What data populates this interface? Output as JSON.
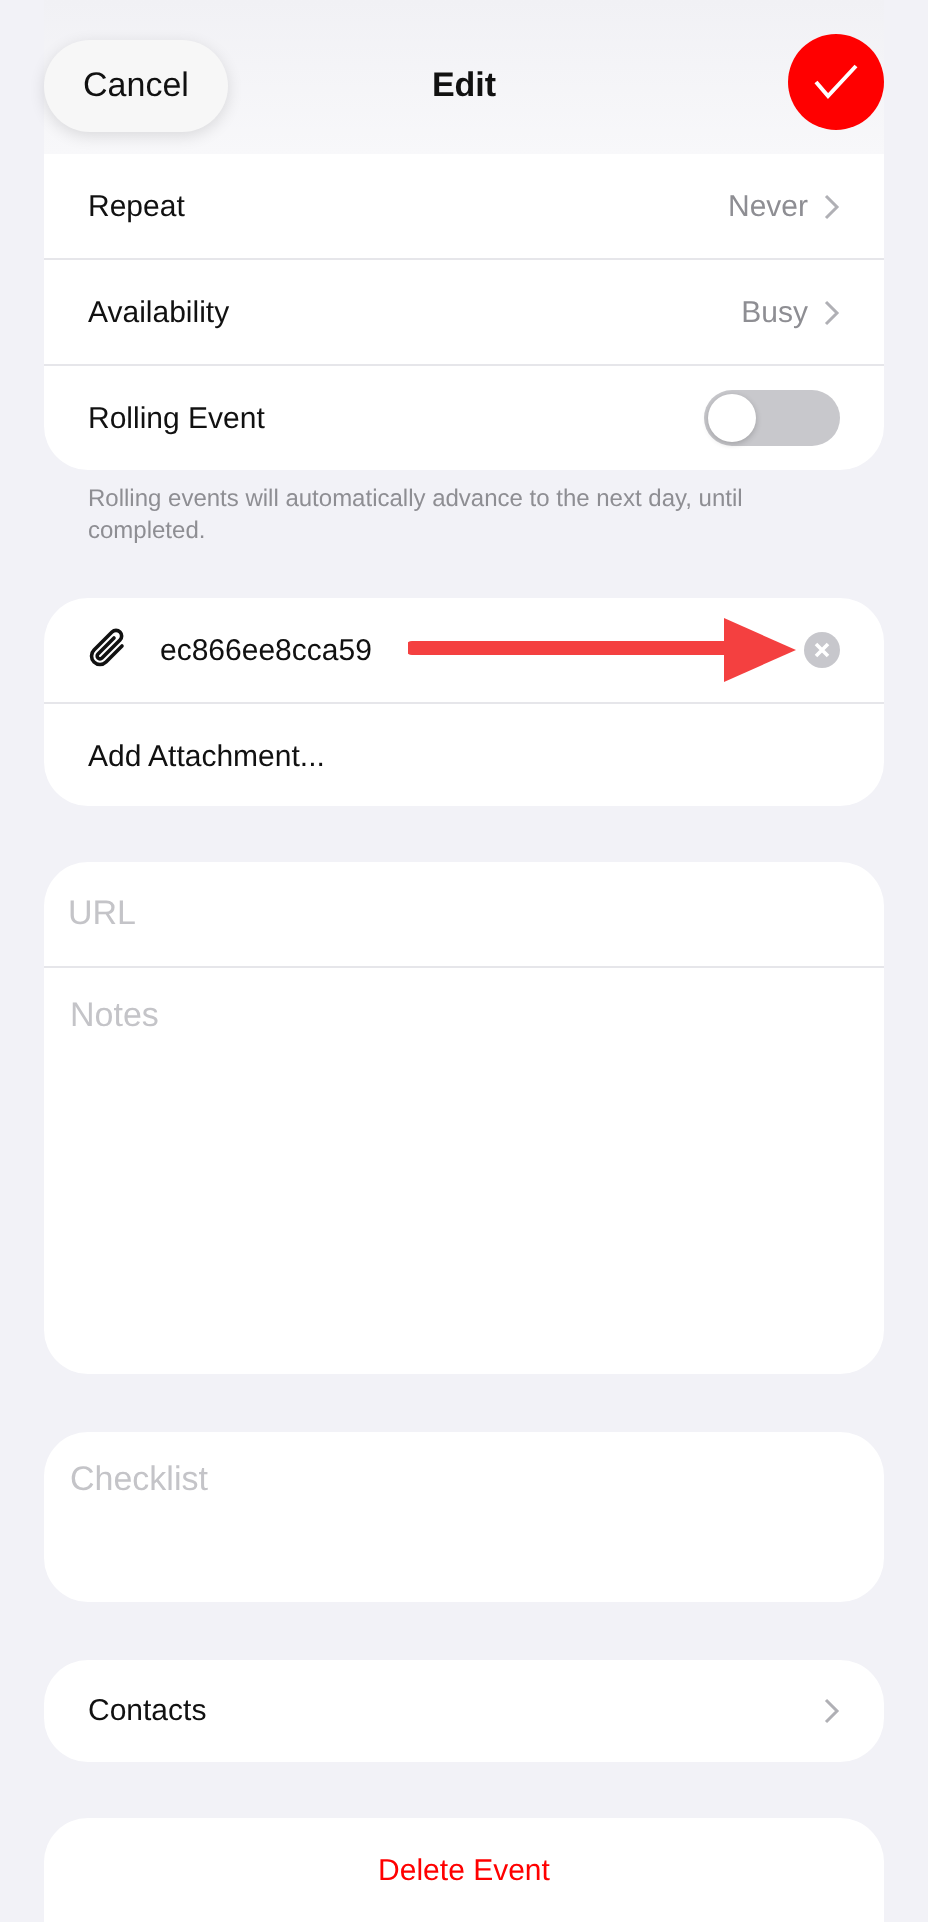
{
  "header": {
    "cancel": "Cancel",
    "title": "Edit"
  },
  "settings": [
    {
      "kind": "value",
      "label": "Repeat",
      "value": "Never"
    },
    {
      "kind": "value",
      "label": "Availability",
      "value": "Busy"
    },
    {
      "kind": "toggle",
      "label": "Rolling Event",
      "on": false
    }
  ],
  "settings_note": "Rolling events will automatically advance to the next day, until completed.",
  "attachments": {
    "file": "ec866ee8cca59",
    "add": "Add Attachment..."
  },
  "url": {
    "placeholder": "URL"
  },
  "notes": {
    "placeholder": "Notes"
  },
  "checklist": {
    "placeholder": "Checklist"
  },
  "contacts": "Contacts",
  "delete": "Delete Event"
}
